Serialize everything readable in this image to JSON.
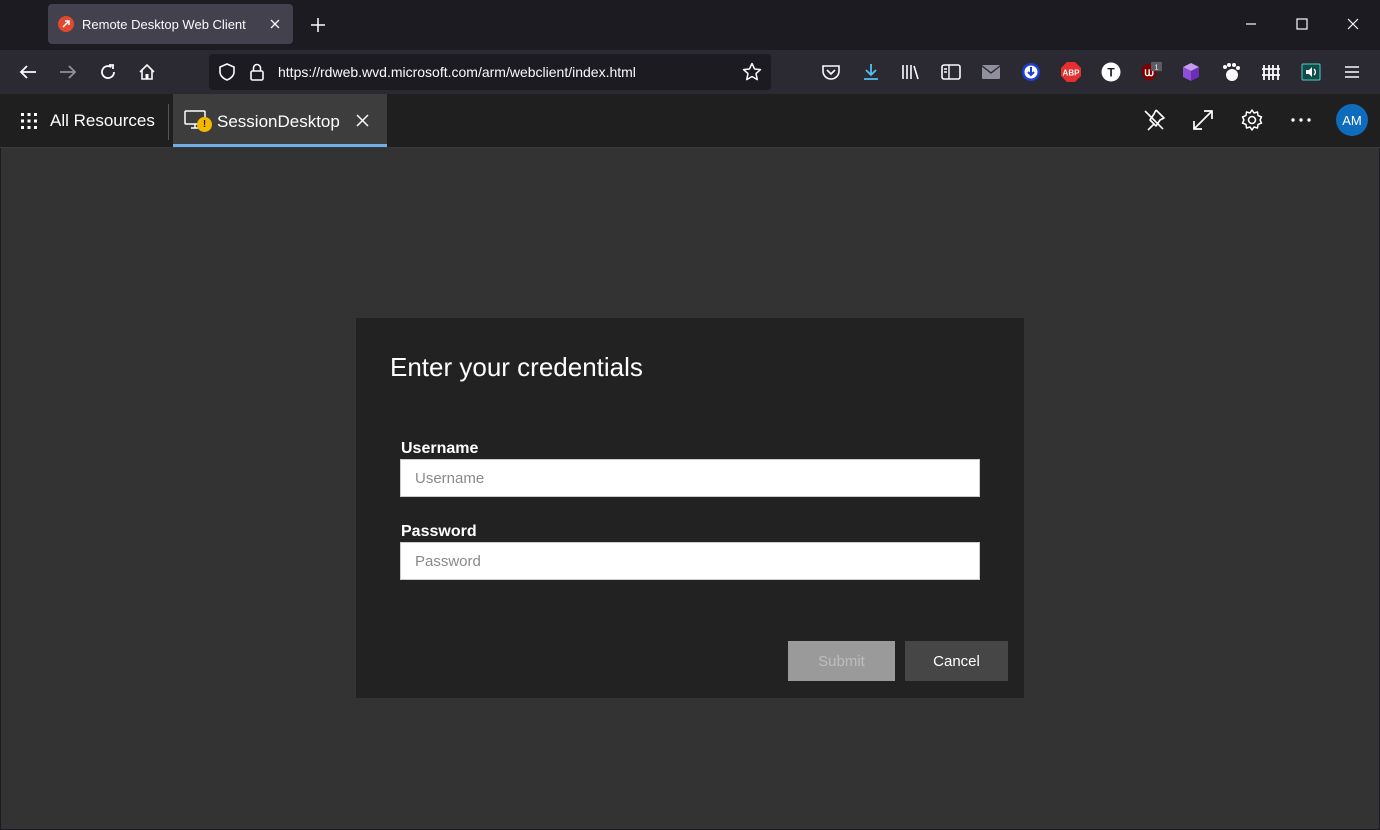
{
  "browser": {
    "tab_title": "Remote Desktop Web Client",
    "url": "https://rdweb.wvd.microsoft.com/arm/webclient/index.html",
    "extension_badge": "1",
    "ext_abp_label": "ABP",
    "ext_t_label": "T"
  },
  "rdclient": {
    "all_resources_label": "All Resources",
    "session_tab_label": "SessionDesktop",
    "session_warning_glyph": "!",
    "avatar_initials": "AM",
    "accent_color": "#6fb0ea"
  },
  "dialog": {
    "title": "Enter your credentials",
    "username_label": "Username",
    "username_placeholder": "Username",
    "username_value": "",
    "password_label": "Password",
    "password_placeholder": "Password",
    "password_value": "",
    "submit_label": "Submit",
    "cancel_label": "Cancel"
  }
}
